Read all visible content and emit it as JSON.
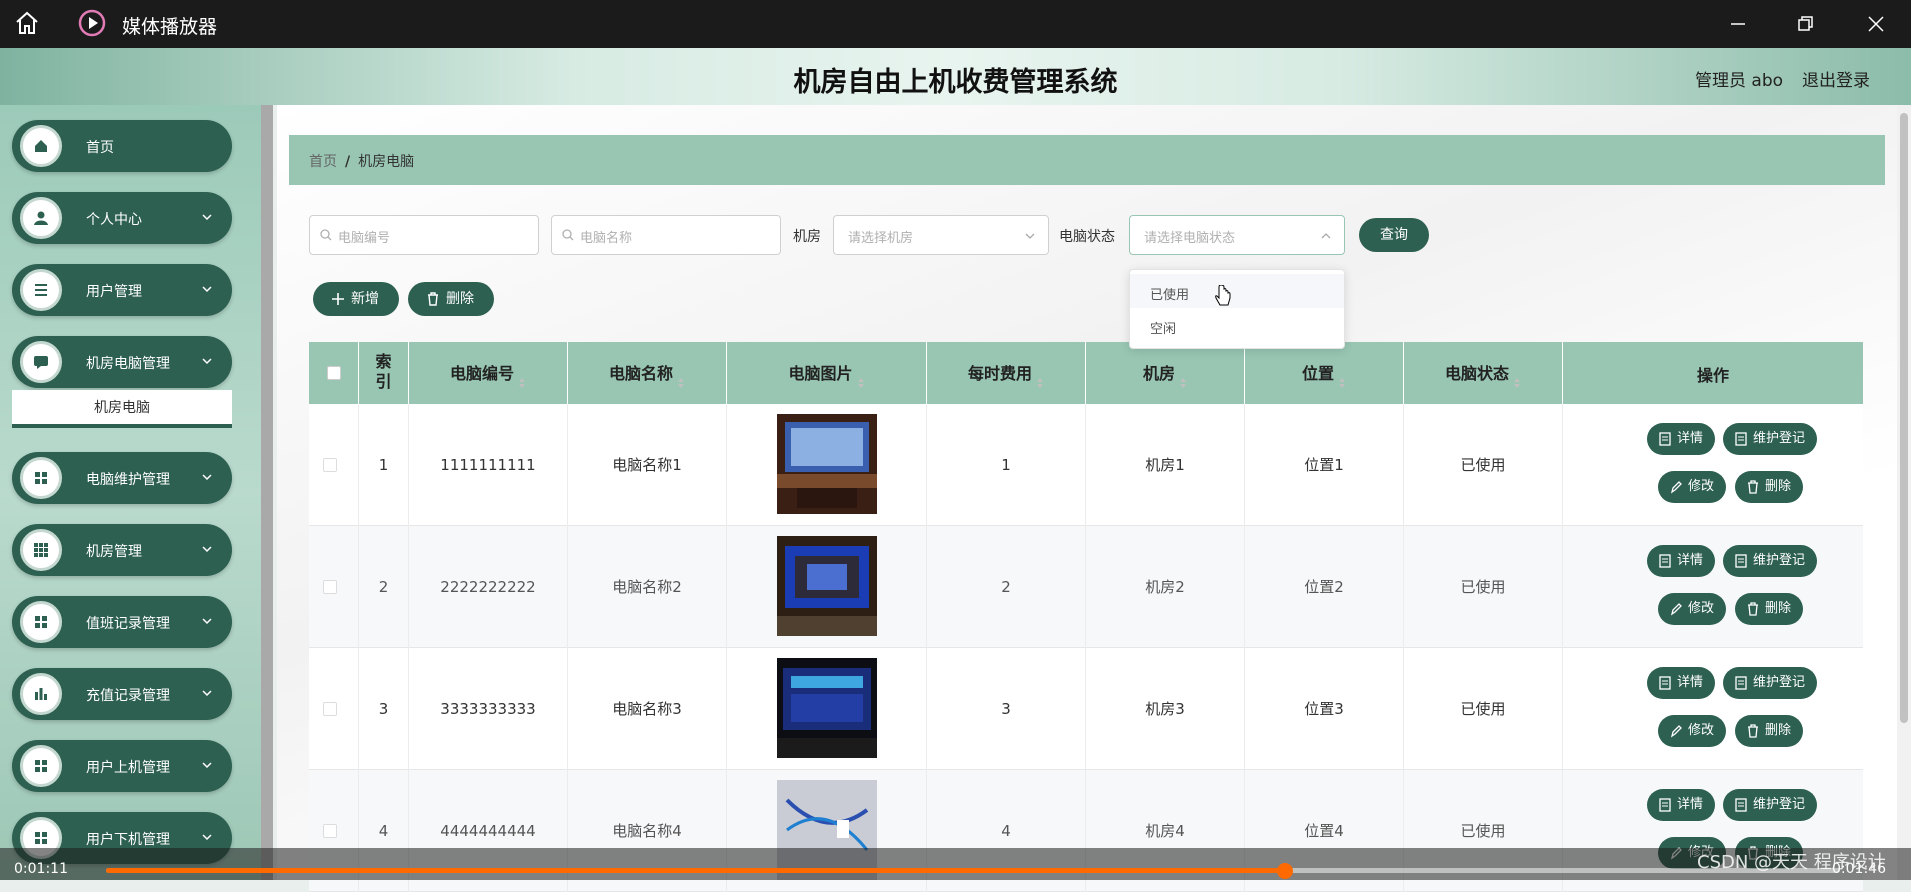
{
  "window": {
    "title": "媒体播放器",
    "minimize": "minimize",
    "maximize": "restore",
    "close": "close"
  },
  "header": {
    "system_title": "机房自由上机收费管理系统",
    "admin": "管理员 abo",
    "logout": "退出登录"
  },
  "sidebar": {
    "items": [
      {
        "label": "首页",
        "icon": "home-icon"
      },
      {
        "label": "个人中心",
        "icon": "user-icon"
      },
      {
        "label": "用户管理",
        "icon": "list-icon"
      },
      {
        "label": "机房电脑管理",
        "icon": "chat-icon"
      },
      {
        "label": "电脑维护管理",
        "icon": "grid-icon"
      },
      {
        "label": "机房管理",
        "icon": "grid9-icon"
      },
      {
        "label": "值班记录管理",
        "icon": "grid-icon"
      },
      {
        "label": "充值记录管理",
        "icon": "chart-icon"
      },
      {
        "label": "用户上机管理",
        "icon": "grid-icon"
      },
      {
        "label": "用户下机管理",
        "icon": "grid-icon"
      }
    ],
    "sub_item": "机房电脑"
  },
  "breadcrumb": {
    "home": "首页",
    "separator": "/",
    "current": "机房电脑"
  },
  "search": {
    "pc_number_placeholder": "电脑编号",
    "pc_name_placeholder": "电脑名称",
    "room_label": "机房",
    "room_placeholder": "请选择机房",
    "status_label": "电脑状态",
    "status_placeholder": "请选择电脑状态",
    "query": "查询"
  },
  "actions": {
    "add": "新增",
    "delete": "删除"
  },
  "dropdown": {
    "options": [
      "已使用",
      "空闲"
    ]
  },
  "table": {
    "headers": [
      "索引",
      "电脑编号",
      "电脑名称",
      "电脑图片",
      "每时费用",
      "机房",
      "位置",
      "电脑状态",
      "操作"
    ],
    "rows": [
      {
        "index": "1",
        "number": "1111111111",
        "name": "电脑名称1",
        "fee": "1",
        "room": "机房1",
        "position": "位置1",
        "status": "已使用"
      },
      {
        "index": "2",
        "number": "2222222222",
        "name": "电脑名称2",
        "fee": "2",
        "room": "机房2",
        "position": "位置2",
        "status": "已使用"
      },
      {
        "index": "3",
        "number": "3333333333",
        "name": "电脑名称3",
        "fee": "3",
        "room": "机房3",
        "position": "位置3",
        "status": "已使用"
      },
      {
        "index": "4",
        "number": "4444444444",
        "name": "电脑名称4",
        "fee": "4",
        "room": "机房4",
        "position": "位置4",
        "status": "已使用"
      }
    ],
    "ops": {
      "detail": "详情",
      "maintain": "维护登记",
      "edit": "修改",
      "delete": "删除"
    }
  },
  "player": {
    "elapsed": "0:01:11",
    "total": "0:01:46",
    "progress": 0.68
  },
  "watermark": "CSDN @天天 程序设计",
  "colors": {
    "primary": "#2d6050",
    "header_bg": "#98c6b3",
    "accent_orange": "#ff6a00"
  }
}
